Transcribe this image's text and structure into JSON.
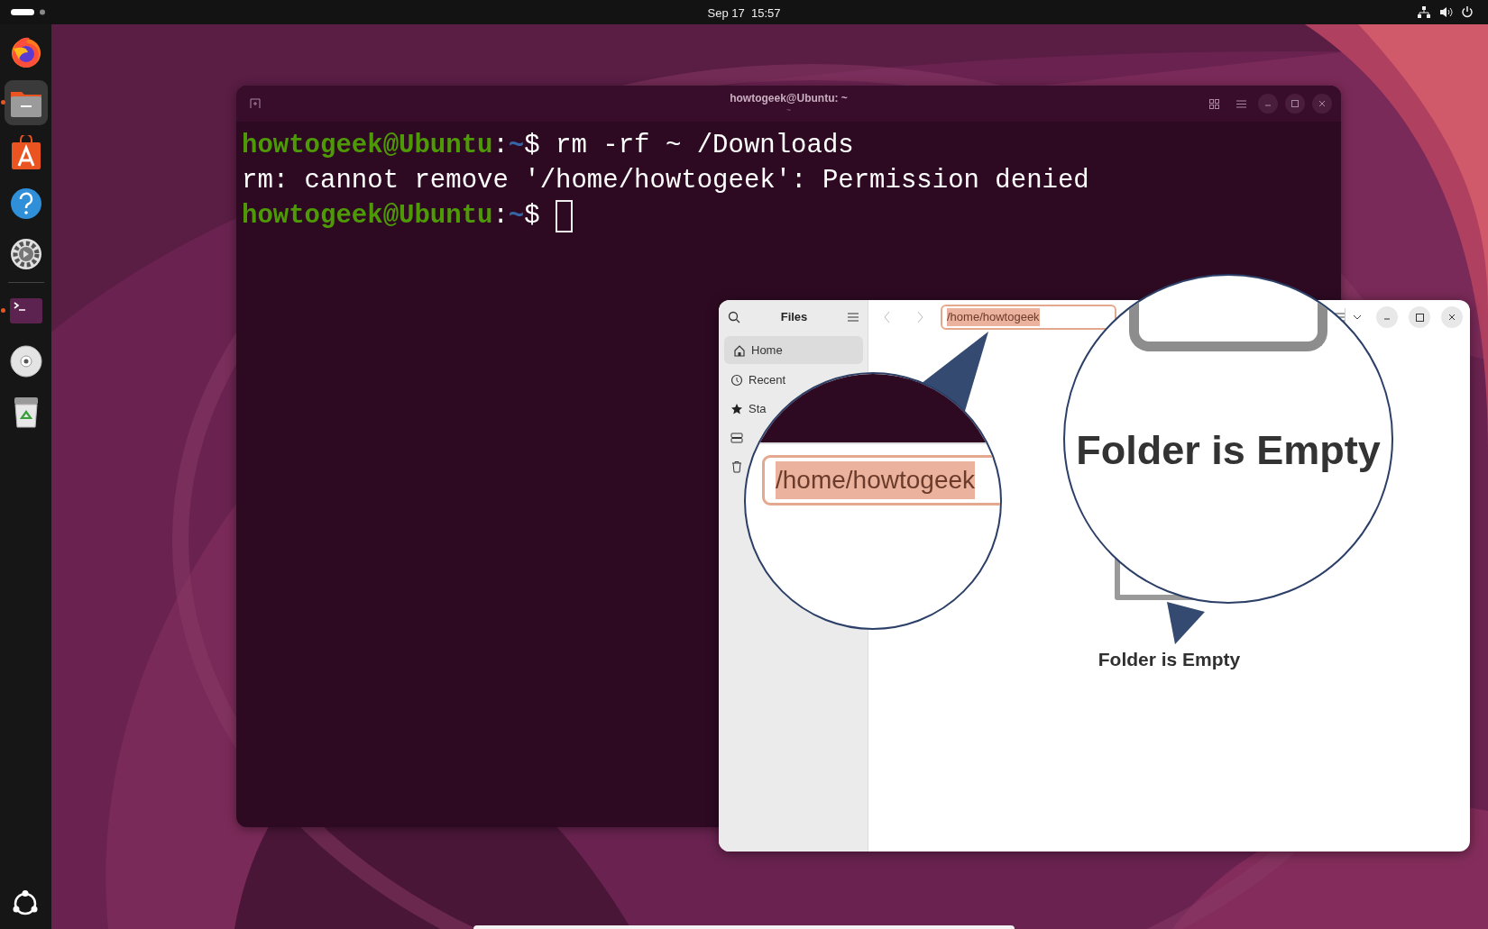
{
  "top_bar": {
    "date": "Sep 17",
    "time": "15:57"
  },
  "dock": {
    "apps": [
      {
        "kind": "browser",
        "running": false,
        "selected": false
      },
      {
        "kind": "files",
        "running": true,
        "selected": true
      },
      {
        "kind": "store",
        "running": false,
        "selected": false
      },
      {
        "kind": "help",
        "running": false,
        "selected": false
      },
      {
        "kind": "settings",
        "running": false,
        "selected": false
      },
      {
        "kind": "separator"
      },
      {
        "kind": "terminal",
        "running": true,
        "selected": false
      },
      {
        "kind": "disc",
        "running": false,
        "selected": false
      },
      {
        "kind": "trash",
        "running": false,
        "selected": false
      }
    ]
  },
  "terminal": {
    "title": "howtogeek@Ubuntu: ~",
    "subtitle": "~",
    "lines": [
      {
        "kind": "prompt",
        "user": "howtogeek@Ubuntu",
        "sep": ":",
        "path": "~",
        "symbol": "$",
        "command": "rm -rf ~ /Downloads"
      },
      {
        "kind": "output",
        "text": "rm: cannot remove '/home/howtogeek': Permission denied"
      },
      {
        "kind": "prompt",
        "user": "howtogeek@Ubuntu",
        "sep": ":",
        "path": "~",
        "symbol": "$",
        "cursor": true
      }
    ]
  },
  "files": {
    "title": "Files",
    "sidebar": [
      {
        "kind": "home",
        "label": "Home",
        "selected": true
      },
      {
        "kind": "recent",
        "label": "Recent",
        "selected": false
      },
      {
        "kind": "starred",
        "label": "Sta",
        "selected": false
      },
      {
        "kind": "drive",
        "selected": false
      },
      {
        "kind": "trash",
        "selected": false
      }
    ],
    "location": "/home/howtogeek",
    "empty_text": "Folder is Empty"
  },
  "magnifiers": [
    {
      "kind": "location",
      "text": "/home/howtogeek"
    },
    {
      "kind": "empty",
      "text": "Folder is Empty"
    }
  ]
}
